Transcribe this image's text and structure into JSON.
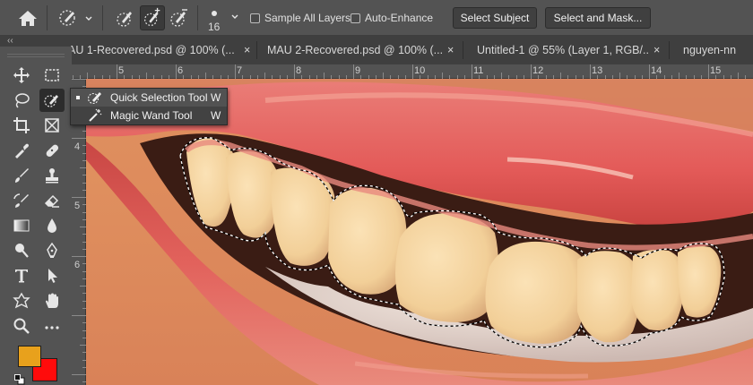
{
  "options_bar": {
    "home_icon": "home-icon",
    "tool_preset_icon": "quick-selection-brush-icon",
    "mode_icons": [
      "new-selection-brush-icon",
      "add-to-selection-brush-icon",
      "subtract-from-selection-brush-icon"
    ],
    "active_mode": 1,
    "brush_size": "16",
    "sample_all_layers_label": "Sample All Layers",
    "auto_enhance_label": "Auto-Enhance",
    "select_subject_label": "Select Subject",
    "select_and_mask_label": "Select and Mask..."
  },
  "tabs": [
    {
      "label": "AU 1-Recovered.psd @ 100% (..."
    },
    {
      "label": "MAU 2-Recovered.psd @ 100% (..."
    },
    {
      "label": "Untitled-1 @ 55% (Layer 1, RGB/..."
    },
    {
      "label": "nguyen-nn"
    }
  ],
  "tab_close_glyph": "×",
  "panel_collapse_glyph": "‹‹",
  "ruler": {
    "horizontal": [
      "5",
      "6",
      "7",
      "8",
      "9",
      "10",
      "11",
      "12",
      "13",
      "14",
      "15"
    ],
    "vertical": [
      "4",
      "5",
      "6"
    ]
  },
  "tool_flyout": {
    "items": [
      {
        "label": "Quick Selection Tool",
        "shortcut": "W",
        "icon": "quick-selection-icon"
      },
      {
        "label": "Magic Wand Tool",
        "shortcut": "W",
        "icon": "magic-wand-icon"
      }
    ]
  },
  "colors": {
    "foreground": "#e8a11c",
    "background": "#ff0b0b",
    "ui_panel": "#535353",
    "tab_bar": "#3f3f3f"
  },
  "toolbar_icons": [
    "move-icon",
    "marquee-icon",
    "lasso-icon",
    "quick-selection-icon",
    "crop-icon",
    "frame-icon",
    "eyedropper-icon",
    "healing-icon",
    "brush-icon",
    "stamp-icon",
    "history-brush-icon",
    "eraser-icon",
    "gradient-icon",
    "blur-icon",
    "dodge-icon",
    "pen-icon",
    "type-icon",
    "path-selection-icon",
    "shape-icon",
    "hand-icon",
    "zoom-icon",
    "more-tools-icon"
  ]
}
